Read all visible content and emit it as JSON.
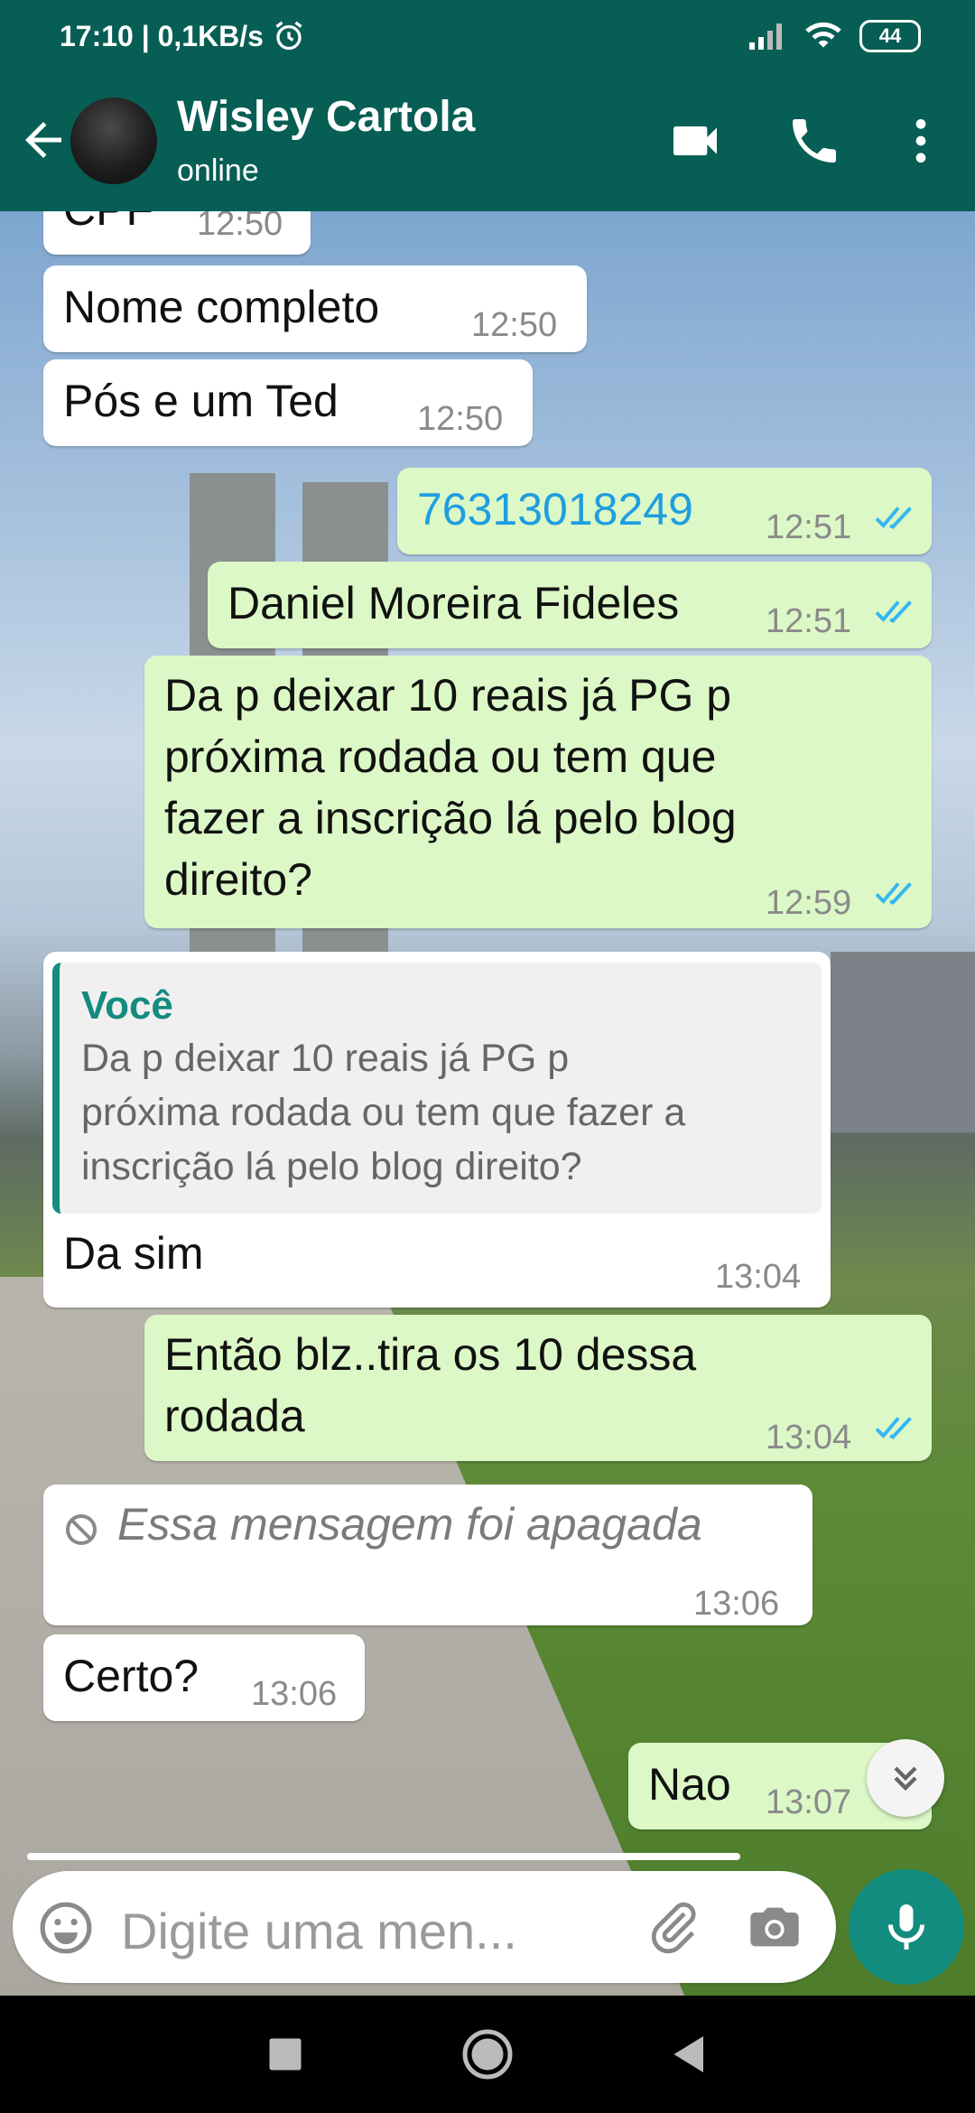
{
  "status_bar": {
    "time_speed": "17:10 | 0,1KB/s",
    "battery": "44"
  },
  "header": {
    "name": "Wisley Cartola",
    "status": "online"
  },
  "messages": [
    {
      "dir": "in",
      "text": "CPF",
      "time": "12:50"
    },
    {
      "dir": "in",
      "text": "Nome completo",
      "time": "12:50"
    },
    {
      "dir": "in",
      "text": "Pós e um Ted",
      "time": "12:50"
    },
    {
      "dir": "out",
      "text": "76313018249",
      "time": "12:51",
      "link": true
    },
    {
      "dir": "out",
      "text": "Daniel Moreira Fideles",
      "time": "12:51"
    },
    {
      "dir": "out",
      "lines": [
        "Da p deixar 10 reais já PG p",
        "próxima rodada ou tem que",
        "fazer a inscrição lá pelo blog",
        "direito?"
      ],
      "time": "12:59"
    },
    {
      "dir": "in",
      "quote_author": "Você",
      "quote_lines": [
        "Da p deixar 10 reais já PG p",
        "próxima rodada ou tem que fazer a",
        "inscrição lá pelo blog direito?"
      ],
      "text": "Da sim",
      "time": "13:04"
    },
    {
      "dir": "out",
      "lines": [
        "Então blz..tira os 10 dessa",
        "rodada"
      ],
      "time": "13:04"
    },
    {
      "dir": "in",
      "text": "Essa mensagem foi apagada",
      "time": "13:06",
      "deleted": true
    },
    {
      "dir": "in",
      "text": "Certo?",
      "time": "13:06"
    },
    {
      "dir": "out",
      "text": "Nao",
      "time": "13:07"
    }
  ],
  "input": {
    "placeholder": "Digite uma men..."
  },
  "colors": {
    "header": "#075e54",
    "outgoing": "#dcf8c6",
    "accent": "#128c7e",
    "tick_blue": "#34b7f1",
    "link": "#039be5"
  },
  "icons": [
    "back-arrow-icon",
    "video-call-icon",
    "phone-icon",
    "more-options-icon",
    "emoji-icon",
    "attach-icon",
    "camera-icon",
    "mic-icon",
    "blocked-icon",
    "double-check-icon",
    "chevron-double-down-icon",
    "signal-icon",
    "wifi-icon",
    "alarm-icon"
  ]
}
